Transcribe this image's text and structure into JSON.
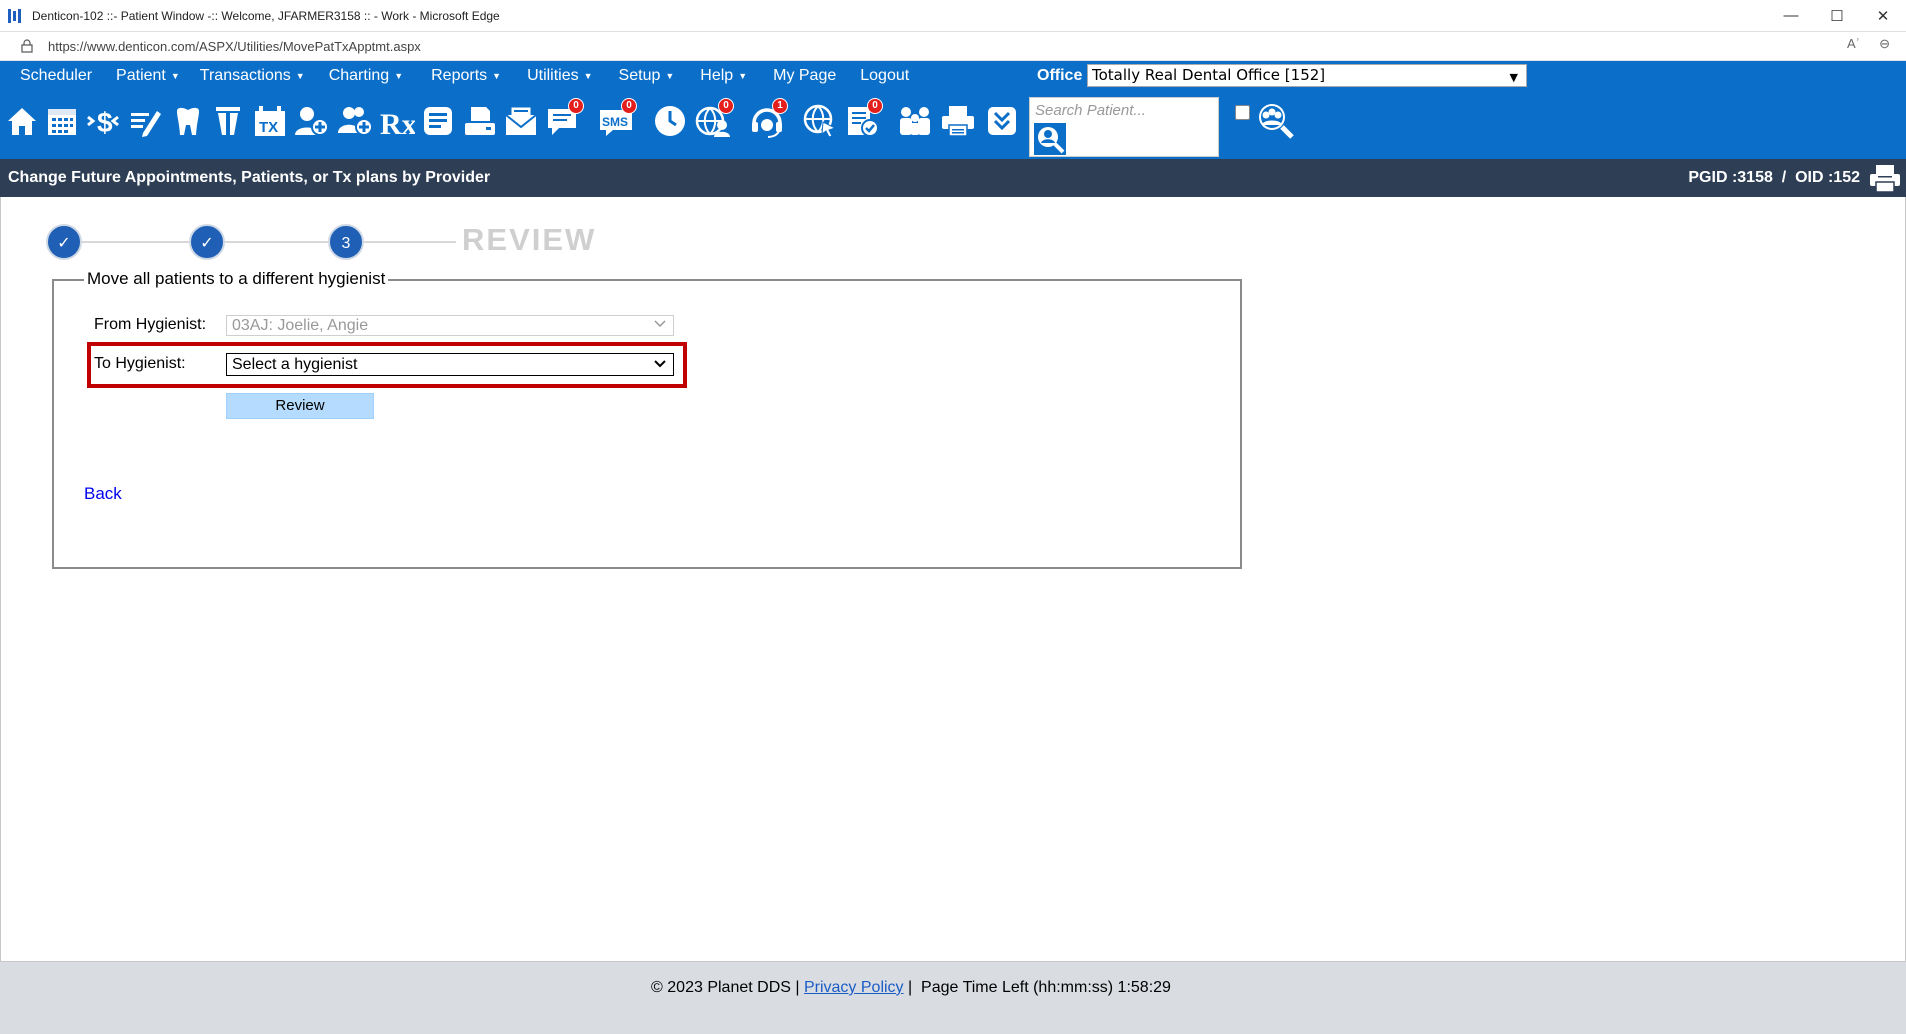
{
  "window": {
    "title": "Denticon-102 ::- Patient Window -:: Welcome, JFARMER3158 :: - Work - Microsoft Edge",
    "minimize": "—",
    "maximize": "☐",
    "close": "✕"
  },
  "address": {
    "url": "https://www.denticon.com/ASPX/Utilities/MovePatTxApptmt.aspx",
    "read_aloud": "Aʾ",
    "zoom": "⊖"
  },
  "menu": {
    "items": [
      {
        "label": "Scheduler",
        "caret": ""
      },
      {
        "label": "Patient",
        "caret": "▼"
      },
      {
        "label": "Transactions",
        "caret": "▼"
      },
      {
        "label": "Charting",
        "caret": "▼"
      },
      {
        "label": "Reports",
        "caret": "▼"
      },
      {
        "label": "Utilities",
        "caret": "▼"
      },
      {
        "label": "Setup",
        "caret": "▼"
      },
      {
        "label": "Help",
        "caret": "▼"
      },
      {
        "label": "My Page",
        "caret": ""
      },
      {
        "label": "Logout",
        "caret": ""
      }
    ],
    "office_label": "Office",
    "office_value": "Totally Real Dental Office [152]"
  },
  "toolbar": {
    "icons": [
      {
        "name": "home-icon"
      },
      {
        "name": "calendar-icon"
      },
      {
        "name": "ledger-dollar-icon"
      },
      {
        "name": "edit-notes-icon"
      },
      {
        "name": "tooth-chart-icon"
      },
      {
        "name": "perio-icon"
      },
      {
        "name": "tx-plan-icon",
        "text": "TX"
      },
      {
        "name": "add-patient-icon"
      },
      {
        "name": "add-family-icon"
      },
      {
        "name": "rx-icon",
        "text": "Rx"
      },
      {
        "name": "document-icon"
      },
      {
        "name": "scanner-icon"
      },
      {
        "name": "mail-icon"
      },
      {
        "name": "messages-icon",
        "badge": "0"
      },
      {
        "name": "sms-icon",
        "badge": "0",
        "text": "SMS"
      },
      {
        "name": "clock-icon"
      },
      {
        "name": "global-users-icon",
        "badge": "0"
      },
      {
        "name": "support-icon",
        "badge": "1"
      },
      {
        "name": "web-click-icon"
      },
      {
        "name": "checklist-icon",
        "badge": "0"
      },
      {
        "name": "family-icon"
      },
      {
        "name": "print-icon"
      },
      {
        "name": "download-icon"
      }
    ],
    "search_placeholder": "Search Patient..."
  },
  "header": {
    "title": "Change Future Appointments, Patients, or Tx plans by Provider",
    "ids": "PGID :3158  /  OID :152"
  },
  "stepper": {
    "steps": [
      "✓",
      "✓",
      "3"
    ],
    "final_label": "REVIEW"
  },
  "form": {
    "legend": "Move all patients to a different hygienist",
    "from_label": "From Hygienist:",
    "from_value": "03AJ: Joelie, Angie",
    "to_label": "To Hygienist:",
    "to_value": "Select a hygienist",
    "review_button": "Review",
    "back_link": "Back"
  },
  "footer": {
    "copyright": "© 2023 Planet DDS | ",
    "privacy": "Privacy Policy",
    "time_left": " |  Page Time Left (hh:mm:ss) 1:58:29"
  },
  "colors": {
    "menu_bg": "#0b6fc9",
    "header_bg": "#2d3e55",
    "step_circle": "#1f5fb5",
    "highlight": "#c00000",
    "review_btn": "#b5dcff"
  }
}
